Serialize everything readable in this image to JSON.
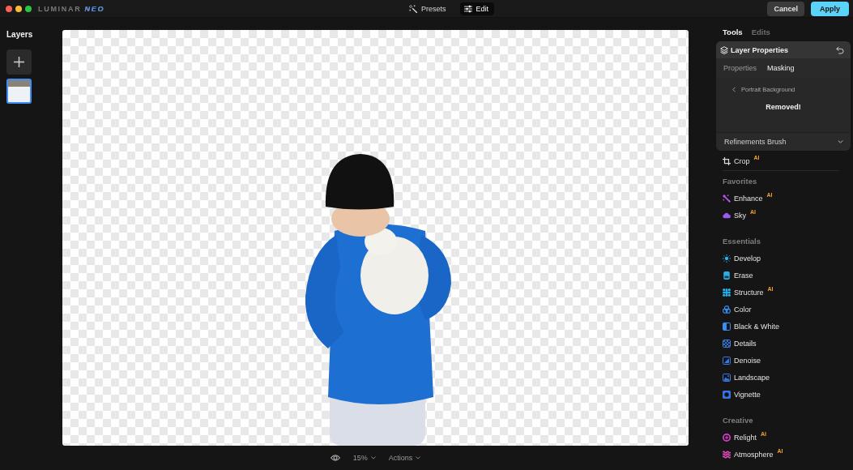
{
  "title_bar": {
    "logo": {
      "name": "LUMINAR",
      "edition": "NEO"
    },
    "modes": [
      {
        "label": "Presets",
        "selected": false
      },
      {
        "label": "Edit",
        "selected": true
      }
    ],
    "buttons": [
      {
        "label": "Cancel",
        "kind": "secondary"
      },
      {
        "label": "Apply",
        "kind": "primary"
      }
    ]
  },
  "layers_panel": {
    "title": "Layers",
    "layers": [
      {
        "selected": true
      }
    ]
  },
  "bottom_bar": {
    "zoom": "15%",
    "menu": "Actions"
  },
  "tools_panel": {
    "tabs": [
      {
        "label": "Tools",
        "selected": true
      },
      {
        "label": "Edits",
        "selected": false
      }
    ],
    "layer_properties": {
      "title": "Layer Properties",
      "tabs": [
        {
          "label": "Properties",
          "selected": false
        },
        {
          "label": "Masking",
          "selected": true
        }
      ],
      "back_label": "Portrait Background",
      "status": "Removed!",
      "refinements": {
        "label": "Refinements Brush",
        "expanded": false
      }
    },
    "pinned_tools": [
      {
        "label": "Crop",
        "badge": "AI",
        "color": "#d8d8d8"
      }
    ],
    "sections": [
      {
        "title": "Favorites",
        "tools": [
          {
            "label": "Enhance",
            "badge": "AI",
            "color": "#b356e8"
          },
          {
            "label": "Sky",
            "badge": "AI",
            "color": "#9a5af0"
          }
        ]
      },
      {
        "title": "Essentials",
        "tools": [
          {
            "label": "Develop",
            "color": "#29b6f0"
          },
          {
            "label": "Erase",
            "color": "#2aaee8"
          },
          {
            "label": "Structure",
            "badge": "AI",
            "color": "#2aaee8"
          },
          {
            "label": "Color",
            "color": "#3a8ef0"
          },
          {
            "label": "Black & White",
            "color": "#3a8ef0"
          },
          {
            "label": "Details",
            "color": "#3a80e8"
          },
          {
            "label": "Denoise",
            "color": "#3a7ae6"
          },
          {
            "label": "Landscape",
            "color": "#3a7ae6"
          },
          {
            "label": "Vignette",
            "color": "#3a72e6"
          }
        ]
      },
      {
        "title": "Creative",
        "tools": [
          {
            "label": "Relight",
            "badge": "AI",
            "color": "#d83ccf"
          },
          {
            "label": "Atmosphere",
            "badge": "AI",
            "color": "#e04ab8"
          }
        ]
      }
    ]
  }
}
